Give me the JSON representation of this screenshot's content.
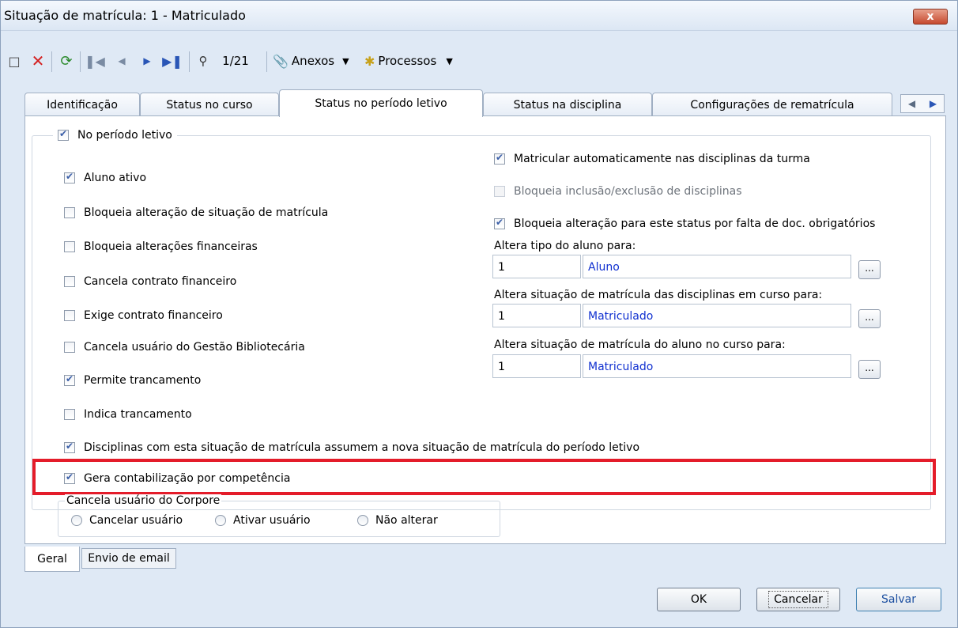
{
  "window": {
    "title": "Situação de matrícula: 1 - Matriculado",
    "close_label": "x"
  },
  "toolbar": {
    "record_position": "1/21",
    "attachments_label": "Anexos",
    "processes_label": "Processos",
    "icons": [
      "new-icon",
      "delete-icon",
      "refresh-icon",
      "first-icon",
      "prev-icon",
      "next-icon",
      "last-icon",
      "find-icon",
      "attachments-icon",
      "processes-icon"
    ]
  },
  "tabs": [
    {
      "label": "Identificação"
    },
    {
      "label": "Status no curso"
    },
    {
      "label": "Status no período letivo"
    },
    {
      "label": "Status na disciplina"
    },
    {
      "label": "Configurações de rematrícula"
    }
  ],
  "active_tab": "Status no período letivo",
  "group": {
    "label": "No período letivo",
    "checked": true
  },
  "left_checks": [
    {
      "label": "Aluno ativo",
      "checked": true
    },
    {
      "label": "Bloqueia alteração de situação de matrícula",
      "checked": false
    },
    {
      "label": "Bloqueia alterações financeiras",
      "checked": false
    },
    {
      "label": "Cancela contrato financeiro",
      "checked": false
    },
    {
      "label": "Exige contrato financeiro",
      "checked": false
    },
    {
      "label": "Cancela usuário do Gestão Bibliotecária",
      "checked": false
    },
    {
      "label": "Permite trancamento",
      "checked": true
    },
    {
      "label": "Indica trancamento",
      "checked": false
    },
    {
      "label": "Disciplinas com esta situação de matrícula assumem a nova situação de matrícula do período letivo",
      "checked": true
    },
    {
      "label": "Gera contabilização por competência",
      "checked": true
    }
  ],
  "right_checks": [
    {
      "label": "Matricular automaticamente nas disciplinas da turma",
      "checked": true,
      "enabled": true
    },
    {
      "label": "Bloqueia inclusão/exclusão de disciplinas",
      "checked": false,
      "enabled": false
    },
    {
      "label": "Bloqueia alteração para este status por falta de doc. obrigatórios",
      "checked": true,
      "enabled": true
    }
  ],
  "lookups": [
    {
      "label": "Altera tipo do aluno para:",
      "code": "1",
      "description": "Aluno",
      "button": "..."
    },
    {
      "label": "Altera situação de matrícula das disciplinas em curso para:",
      "code": "1",
      "description": "Matriculado",
      "button": "..."
    },
    {
      "label": "Altera situação de matrícula do aluno no curso para:",
      "code": "1",
      "description": "Matriculado",
      "button": "..."
    }
  ],
  "corpore_group": {
    "legend": "Cancela usuário do Corpore",
    "options": [
      "Cancelar usuário",
      "Ativar usuário",
      "Não alterar"
    ]
  },
  "bottom_tabs": [
    {
      "label": "Geral",
      "active": true
    },
    {
      "label": "Envio de email",
      "active": false
    }
  ],
  "buttons": {
    "ok": "OK",
    "cancel": "Cancelar",
    "save": "Salvar"
  },
  "colors": {
    "highlight": "#e41c2a",
    "link_blue": "#1030d0"
  }
}
